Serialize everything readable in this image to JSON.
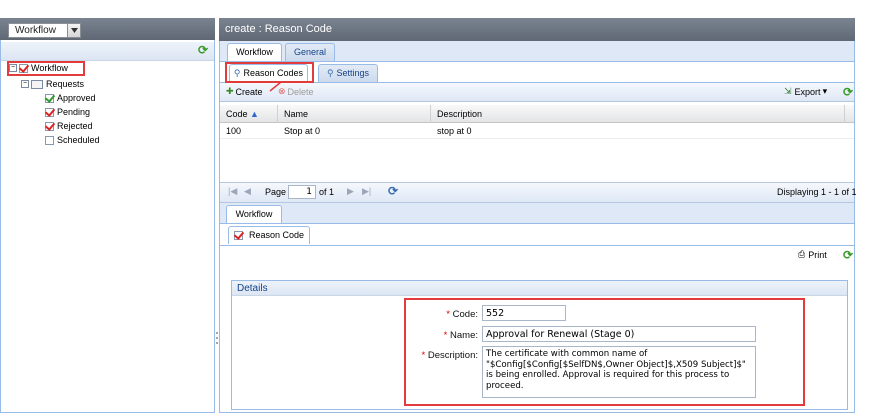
{
  "left_panel": {
    "selector_value": "Workflow",
    "tree": [
      {
        "label": "Workflow",
        "check": "red",
        "toggle": "−",
        "level": 0
      },
      {
        "label": "Requests",
        "check": "folder",
        "toggle": "−",
        "level": 1
      },
      {
        "label": "Approved",
        "check": "green",
        "level": 2
      },
      {
        "label": "Pending",
        "check": "red",
        "level": 2
      },
      {
        "label": "Rejected",
        "check": "red",
        "level": 2
      },
      {
        "label": "Scheduled",
        "check": "none",
        "level": 2
      }
    ]
  },
  "main": {
    "title": "create : Reason Code",
    "top_tabs": [
      "Workflow",
      "General"
    ],
    "sub_tabs": [
      "Reason Codes",
      "Settings"
    ],
    "toolbar": {
      "create": "Create",
      "delete": "Delete",
      "export": "Export"
    },
    "grid": {
      "columns": [
        "Code",
        "Name",
        "Description"
      ],
      "rows": [
        {
          "code": "100",
          "name": "Stop at 0",
          "description": "stop at 0"
        }
      ]
    },
    "pager": {
      "page_label": "Page",
      "page_value": "1",
      "of_label": "of 1",
      "displaying": "Displaying 1 - 1 of 1"
    },
    "detail_tab": "Workflow",
    "detail_sub_tab": "Reason Code",
    "print_label": "Print",
    "details": {
      "legend": "Details",
      "code_label": "Code:",
      "code_value": "552",
      "name_label": "Name:",
      "name_value": "Approval for Renewal (Stage 0)",
      "description_label": "Description:",
      "description_value": "The certificate with common name of \"$Config[$Config[$SelfDN$,Owner Object]$,X509 Subject]$\" is being enrolled. Approval is required for this process to proceed."
    }
  },
  "colors": {
    "highlight": "#e23b3b",
    "header": "#6b7480",
    "accent": "#99bbe8"
  }
}
